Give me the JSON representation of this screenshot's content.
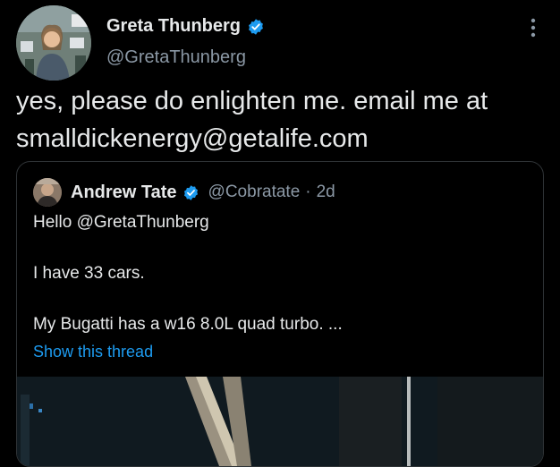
{
  "author": {
    "name": "Greta Thunberg",
    "handle": "@GretaThunberg",
    "verified": true,
    "verified_color": "#1d9bf0",
    "avatar_icon": "profile-photo"
  },
  "more_icon": "more-vertical-icon",
  "tweet": {
    "lines": [
      "yes, please do enlighten me. email me at",
      "smalldickenergy@getalife.com"
    ]
  },
  "quoted": {
    "name": "Andrew Tate",
    "handle": "@Cobratate",
    "separator": "·",
    "time": "2d",
    "verified": true,
    "lines": [
      "Hello @GretaThunberg",
      "I have 33 cars.",
      "My Bugatti has a w16 8.0L quad turbo. ..."
    ],
    "show_thread": "Show this thread"
  },
  "colors": {
    "background": "#000000",
    "text": "#e7e9ea",
    "secondary": "#8b98a5",
    "link": "#1d9bf0",
    "border": "#2f3336"
  }
}
